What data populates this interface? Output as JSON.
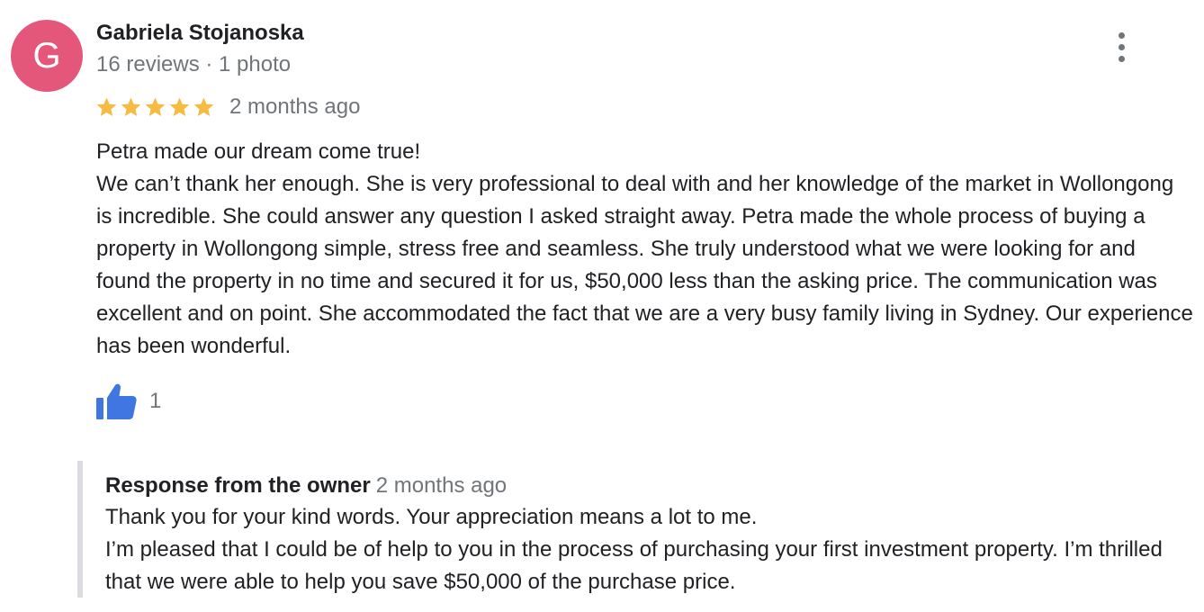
{
  "reviewer": {
    "initial": "G",
    "avatar_color": "#e4577a",
    "name": "Gabriela Stojanoska",
    "meta": "16 reviews · 1 photo"
  },
  "review": {
    "rating": 5,
    "max_rating": 5,
    "star_color": "#f6bb42",
    "date": "2 months ago",
    "text_lines": [
      "Petra made our dream come true!",
      "We can’t thank her enough. She is very professional to deal with and her knowledge of the market in Wollongong is incredible. She could answer any question I asked straight away. Petra made the whole process of buying a property in Wollongong simple, stress free and seamless. She truly understood what we were looking for and found the property in no time and secured it for us, $50,000 less than the asking price. The communication was excellent and on point. She accommodated the fact that we are a very busy family living in Sydney. Our experience has been wonderful."
    ],
    "like_icon": "thumbs-up-icon",
    "like_color": "#3f76e1",
    "like_count": "1",
    "more_icon": "more-vert-icon"
  },
  "owner_response": {
    "label": "Response from the owner",
    "date": "2 months ago",
    "text_lines": [
      "Thank you for your kind words. Your appreciation means a lot to me.",
      "I’m pleased that I could be of help to you in the process of purchasing your first investment property. I’m thrilled that we were able to help you save $50,000 of the purchase price."
    ]
  }
}
